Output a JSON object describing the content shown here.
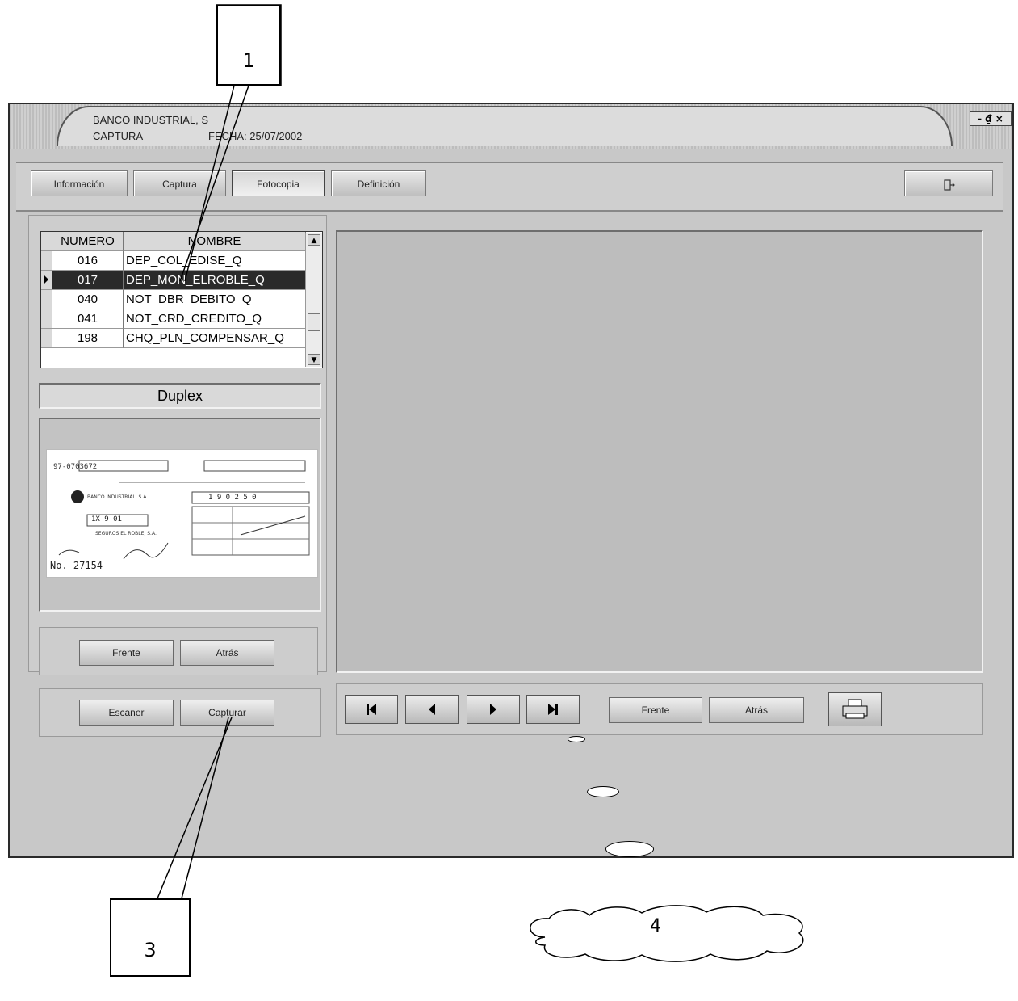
{
  "window": {
    "title_line1": "BANCO INDUSTRIAL, S",
    "title_line2": "CAPTURA",
    "date_label": "FECHA: 25/07/2002",
    "controls": "- ₫ ×"
  },
  "tabs": [
    {
      "label": "Información"
    },
    {
      "label": "Captura"
    },
    {
      "label": "Fotocopia"
    },
    {
      "label": "Definición"
    }
  ],
  "grid": {
    "headers": [
      "NUMERO",
      "NOMBRE"
    ],
    "rows": [
      {
        "numero": "016",
        "nombre": "DEP_COL_EDISE_Q"
      },
      {
        "numero": "017",
        "nombre": "DEP_MON_ELROBLE_Q"
      },
      {
        "numero": "040",
        "nombre": "NOT_DBR_DEBITO_Q"
      },
      {
        "numero": "041",
        "nombre": "NOT_CRD_CREDITO_Q"
      },
      {
        "numero": "198",
        "nombre": "CHQ_PLN_COMPENSAR_Q"
      }
    ],
    "selected_index": 1
  },
  "duplex_label": "Duplex",
  "preview": {
    "doc_number": "No. 27154",
    "account": "97-0703672",
    "bank": "BANCO INDUSTRIAL, S.A.",
    "amount_digits": "1 9 0 2 5 0",
    "date_digits": "1X  9  01",
    "company": "SEGUROS EL ROBLE, S.A."
  },
  "side_buttons": {
    "frente": "Frente",
    "atras": "Atrás"
  },
  "action_buttons": {
    "escaner": "Escaner",
    "capturar": "Capturar"
  },
  "viewer_buttons": {
    "frente": "Frente",
    "atras": "Atrás"
  },
  "callouts": {
    "one": "1",
    "three": "3",
    "four": "4"
  }
}
